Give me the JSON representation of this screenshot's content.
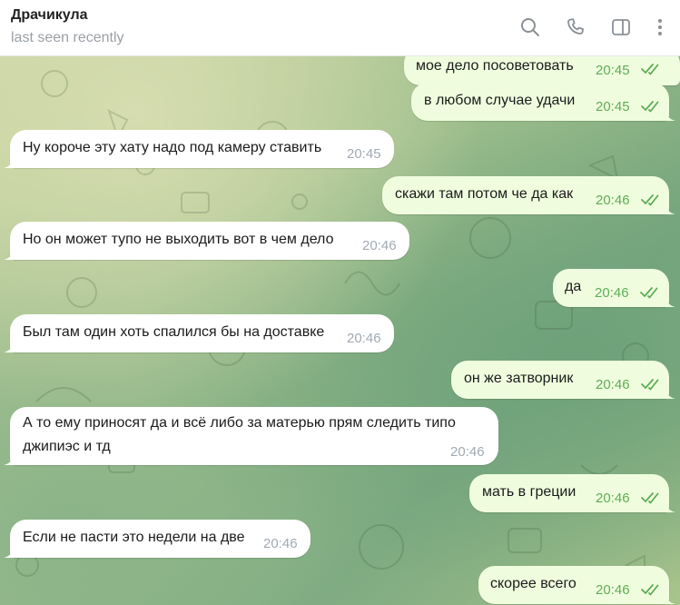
{
  "header": {
    "name": "Драчикула",
    "status": "last seen recently",
    "icons": [
      "search-icon",
      "phone-icon",
      "sidebar-toggle-icon",
      "more-vertical-icon"
    ]
  },
  "colors": {
    "incoming_bubble": "#ffffff",
    "outgoing_bubble": "#effdde",
    "outgoing_time": "#5fad56",
    "incoming_time": "#a1aab3"
  },
  "messages": [
    {
      "dir": "out",
      "text": "мое дело посоветовать",
      "time": "20:45"
    },
    {
      "dir": "out",
      "text": "в любом случае удачи",
      "time": "20:45"
    },
    {
      "dir": "in",
      "text": "Ну короче эту хату надо под камеру ставить",
      "time": "20:45"
    },
    {
      "dir": "out",
      "text": "скажи там потом че да как",
      "time": "20:46"
    },
    {
      "dir": "in",
      "text": "Но он может тупо не выходить вот в чем дело",
      "time": "20:46"
    },
    {
      "dir": "out",
      "text": "да",
      "time": "20:46"
    },
    {
      "dir": "in",
      "text": "Был там один хоть спалился бы на доставке",
      "time": "20:46"
    },
    {
      "dir": "out",
      "text": "он же затворник",
      "time": "20:46"
    },
    {
      "dir": "in",
      "text_line1": "А то ему приносят да и всё либо за матерью прям следить типо",
      "text_line2": "джипиэс и тд",
      "time": "20:46"
    },
    {
      "dir": "out",
      "text": "мать в греции",
      "time": "20:46"
    },
    {
      "dir": "in",
      "text": "Если не пасти это недели на две",
      "time": "20:46"
    },
    {
      "dir": "out",
      "text": "скорее всего",
      "time": "20:46"
    }
  ]
}
